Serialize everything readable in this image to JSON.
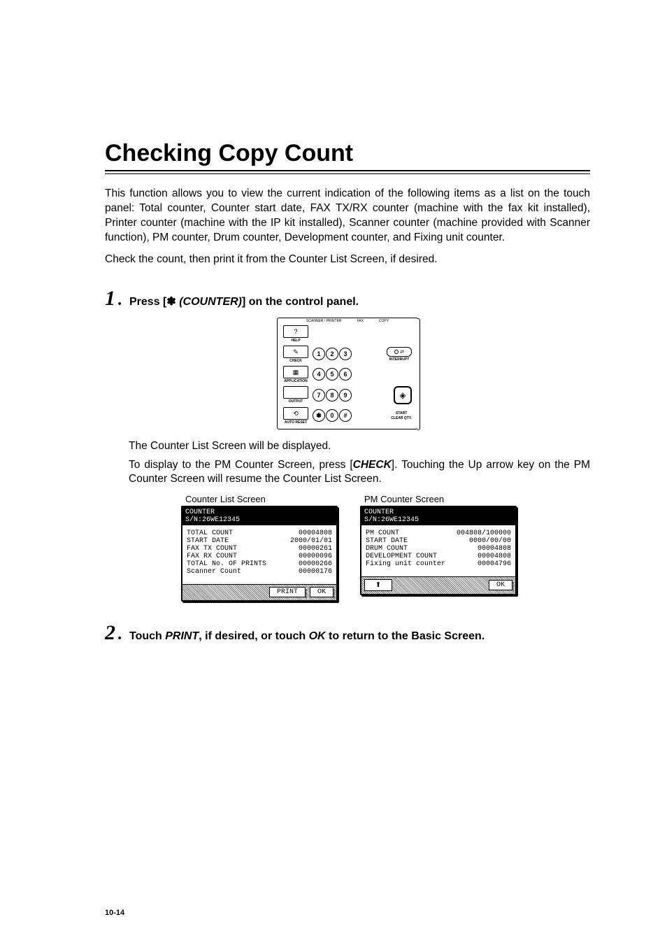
{
  "title": "Checking Copy Count",
  "intro_p1": "This function allows you to view the current indication of the following items as a list on the touch panel: Total counter, Counter start date, FAX TX/RX counter (machine with the fax kit installed), Printer counter (machine with the IP kit installed), Scanner counter (machine provided with Scanner function), PM counter, Drum counter, Development counter, and Fixing unit counter.",
  "intro_p2": "Check the count, then print it from the Counter List Screen, if desired.",
  "step1_num": "1",
  "step1_pre": "Press [",
  "step1_glyph": "✽",
  "step1_italic": " (COUNTER)",
  "step1_post": "] on the control panel.",
  "panel": {
    "top_tabs": [
      "SCANNER / PRINTER",
      "FAX",
      "COPY"
    ],
    "help_label": "HELP",
    "check_label": "CHECK",
    "application_label": "APPLICATION",
    "output_label": "OUTPUT",
    "autoreset_label": "AUTO RESET",
    "interrupt_label": "INTERRUPT",
    "start_label": "START",
    "clear_qty_label": "CLEAR QTY.",
    "keys": [
      "1",
      "2",
      "3",
      "4",
      "5",
      "6",
      "7",
      "8",
      "9",
      "✽",
      "0",
      "#"
    ]
  },
  "sub1_pre": "The Counter List Screen will be displayed.",
  "sub2_pre": "To display to the PM Counter Screen, press [",
  "sub2_italic": "CHECK",
  "sub2_post": "]. Touching the Up arrow key on the PM Counter Screen will resume the Counter List Screen.",
  "screen1": {
    "caption": "Counter List Screen",
    "header_l1": "COUNTER",
    "header_l2": "S/N:26WE12345",
    "rows": [
      {
        "label": "TOTAL COUNT",
        "value": "00004808"
      },
      {
        "label": "START DATE",
        "value": "2000/01/01"
      },
      {
        "label": "FAX TX COUNT",
        "value": "00000261"
      },
      {
        "label": "FAX RX COUNT",
        "value": "00000096"
      },
      {
        "label": "TOTAL No. OF PRINTS",
        "value": "00000266"
      },
      {
        "label": "Scanner Count",
        "value": "00000176"
      }
    ],
    "btn_print": "PRINT",
    "btn_ok": "OK"
  },
  "screen2": {
    "caption": "PM Counter Screen",
    "header_l1": "COUNTER",
    "header_l2": "S/N:26WE12345",
    "rows": [
      {
        "label": "PM COUNT",
        "value": "004808/100000"
      },
      {
        "label": "START DATE",
        "value": "0000/00/00"
      },
      {
        "label": "DRUM COUNT",
        "value": "00004808"
      },
      {
        "label": "DEVELOPMENT COUNT",
        "value": "00004808"
      },
      {
        "label": "Fixing unit counter",
        "value": "00004796"
      }
    ],
    "btn_ok": "OK"
  },
  "step2_num": "2",
  "step2_pre": "Touch ",
  "step2_italic1": "PRINT",
  "step2_mid": ", if desired, or touch ",
  "step2_italic2": "OK",
  "step2_post": " to return to the Basic Screen.",
  "page_number": "10-14"
}
